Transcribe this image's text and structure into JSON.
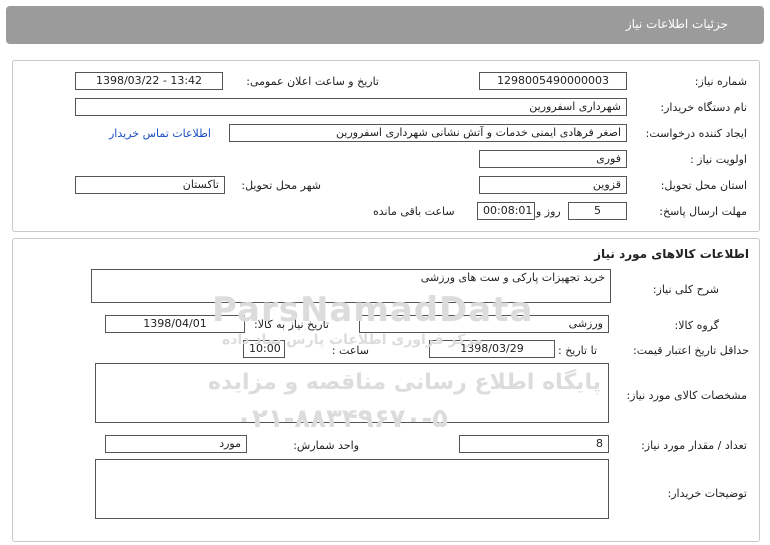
{
  "header": {
    "title": "جزئیات اطلاعات نیاز"
  },
  "need_info": {
    "need_number_label": "شماره نیاز:",
    "need_number": "1298005490000003",
    "announce_label": "تاریخ و ساعت اعلان عمومی:",
    "announce_value": "1398/03/22 - 13:42",
    "buyer_label": "نام دستگاه خریدار:",
    "buyer_value": "شهرداری اسفرورین",
    "creator_label": "ایجاد کننده درخواست:",
    "creator_value": "اصغر فرهادی ایمنی خدمات و آتش نشانی شهرداری اسفرورین",
    "contact_link": "اطلاعات تماس خریدار",
    "priority_label": "اولویت نیاز :",
    "priority_value": "فوری",
    "province_label": "استان محل تحویل:",
    "province_value": "قزوین",
    "city_label": "شهر محل تحویل:",
    "city_value": "تاکستان",
    "deadline_label": "مهلت ارسال پاسخ:",
    "days_value": "5",
    "days_text": "روز و",
    "time_value": "00:08:01",
    "remaining_text": "ساعت باقی مانده"
  },
  "goods": {
    "title": "اطلاعات کالاهای مورد نیاز",
    "desc_label": "شرح کلی نیاز:",
    "desc_value": "خرید تجهیزات پارکی و ست های ورزشی",
    "group_label": "گروه کالا:",
    "group_value": "ورزشی",
    "need_date_label": "تاریخ نیاز به کالا:",
    "need_date_value": "1398/04/01",
    "validity_label": "حداقل تاریخ اعتبار قیمت:",
    "until_date_label": "تا تاریخ :",
    "until_date_value": "1398/03/29",
    "hour_label": "ساعت :",
    "hour_value": "10:00",
    "specs_label": "مشخصات کالای مورد نیاز:",
    "specs_value": "",
    "qty_label": "تعداد / مقدار مورد نیاز:",
    "qty_value": "8",
    "unit_label": "واحد شمارش:",
    "unit_value": "مورد",
    "buyer_notes_label": "توضیحات خریدار:",
    "buyer_notes_value": ""
  },
  "watermark": {
    "brand": "ParsNamadData",
    "line1": "پایگاه اطلاع رسانی مناقصه و مزایده",
    "line2": "۰۲۱-۸۸۳۴۹۶۷۰-۵",
    "line3": "مرکز فراوری اطلاعات پارس نماد داده"
  }
}
